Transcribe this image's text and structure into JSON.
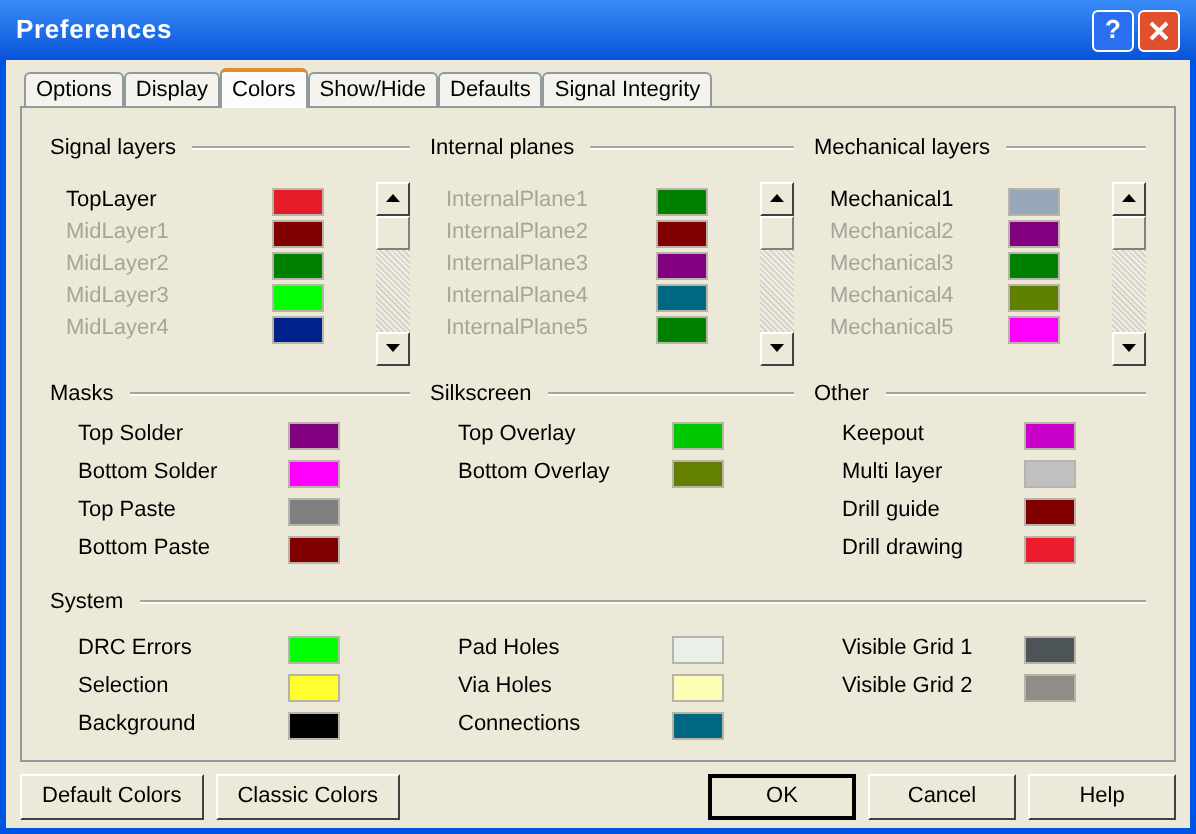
{
  "window": {
    "title": "Preferences",
    "help_button": "?"
  },
  "tabs": [
    {
      "label": "Options",
      "selected": false
    },
    {
      "label": "Display",
      "selected": false
    },
    {
      "label": "Colors",
      "selected": true
    },
    {
      "label": "Show/Hide",
      "selected": false
    },
    {
      "label": "Defaults",
      "selected": false
    },
    {
      "label": "Signal Integrity",
      "selected": false
    }
  ],
  "layer_lists": [
    {
      "title": "Signal layers",
      "items": [
        {
          "name": "TopLayer",
          "color": "#e41c28",
          "enabled": true
        },
        {
          "name": "MidLayer1",
          "color": "#800000",
          "enabled": false
        },
        {
          "name": "MidLayer2",
          "color": "#008000",
          "enabled": false
        },
        {
          "name": "MidLayer3",
          "color": "#00ff00",
          "enabled": false
        },
        {
          "name": "MidLayer4",
          "color": "#00208c",
          "enabled": false
        }
      ]
    },
    {
      "title": "Internal planes",
      "items": [
        {
          "name": "InternalPlane1",
          "color": "#008000",
          "enabled": false
        },
        {
          "name": "InternalPlane2",
          "color": "#800000",
          "enabled": false
        },
        {
          "name": "InternalPlane3",
          "color": "#800080",
          "enabled": false
        },
        {
          "name": "InternalPlane4",
          "color": "#006880",
          "enabled": false
        },
        {
          "name": "InternalPlane5",
          "color": "#008000",
          "enabled": false
        }
      ]
    },
    {
      "title": "Mechanical layers",
      "items": [
        {
          "name": "Mechanical1",
          "color": "#98a8b8",
          "enabled": true
        },
        {
          "name": "Mechanical2",
          "color": "#800080",
          "enabled": false
        },
        {
          "name": "Mechanical3",
          "color": "#008000",
          "enabled": false
        },
        {
          "name": "Mechanical4",
          "color": "#608000",
          "enabled": false
        },
        {
          "name": "Mechanical5",
          "color": "#ff00ff",
          "enabled": false
        }
      ]
    }
  ],
  "sections": [
    {
      "title": "Masks",
      "items": [
        {
          "name": "Top Solder",
          "color": "#800080"
        },
        {
          "name": "Bottom Solder",
          "color": "#ff00ff"
        },
        {
          "name": "Top Paste",
          "color": "#808080"
        },
        {
          "name": "Bottom Paste",
          "color": "#800000"
        }
      ]
    },
    {
      "title": "Silkscreen",
      "items": [
        {
          "name": "Top Overlay",
          "color": "#00c800"
        },
        {
          "name": "Bottom Overlay",
          "color": "#648000"
        }
      ]
    },
    {
      "title": "Other",
      "items": [
        {
          "name": "Keepout",
          "color": "#c800c8"
        },
        {
          "name": "Multi layer",
          "color": "#c0c0c0"
        },
        {
          "name": "Drill guide",
          "color": "#800000"
        },
        {
          "name": "Drill drawing",
          "color": "#ec1c2c"
        }
      ]
    }
  ],
  "system": {
    "title": "System",
    "columns": [
      {
        "items": [
          {
            "name": "DRC Errors",
            "color": "#00ff00"
          },
          {
            "name": "Selection",
            "color": "#ffff30"
          },
          {
            "name": "Background",
            "color": "#000000"
          }
        ]
      },
      {
        "items": [
          {
            "name": "Pad Holes",
            "color": "#e8f0e8"
          },
          {
            "name": "Via Holes",
            "color": "#fcfcb4"
          },
          {
            "name": "Connections",
            "color": "#006880"
          }
        ]
      },
      {
        "items": [
          {
            "name": "Visible Grid 1",
            "color": "#4c5458"
          },
          {
            "name": "Visible Grid 2",
            "color": "#908c88"
          }
        ]
      }
    ]
  },
  "left_buttons": [
    "Default Colors",
    "Classic Colors"
  ],
  "right_buttons": [
    {
      "label": "OK",
      "default": true
    },
    {
      "label": "Cancel",
      "default": false
    },
    {
      "label": "Help",
      "default": false
    }
  ]
}
